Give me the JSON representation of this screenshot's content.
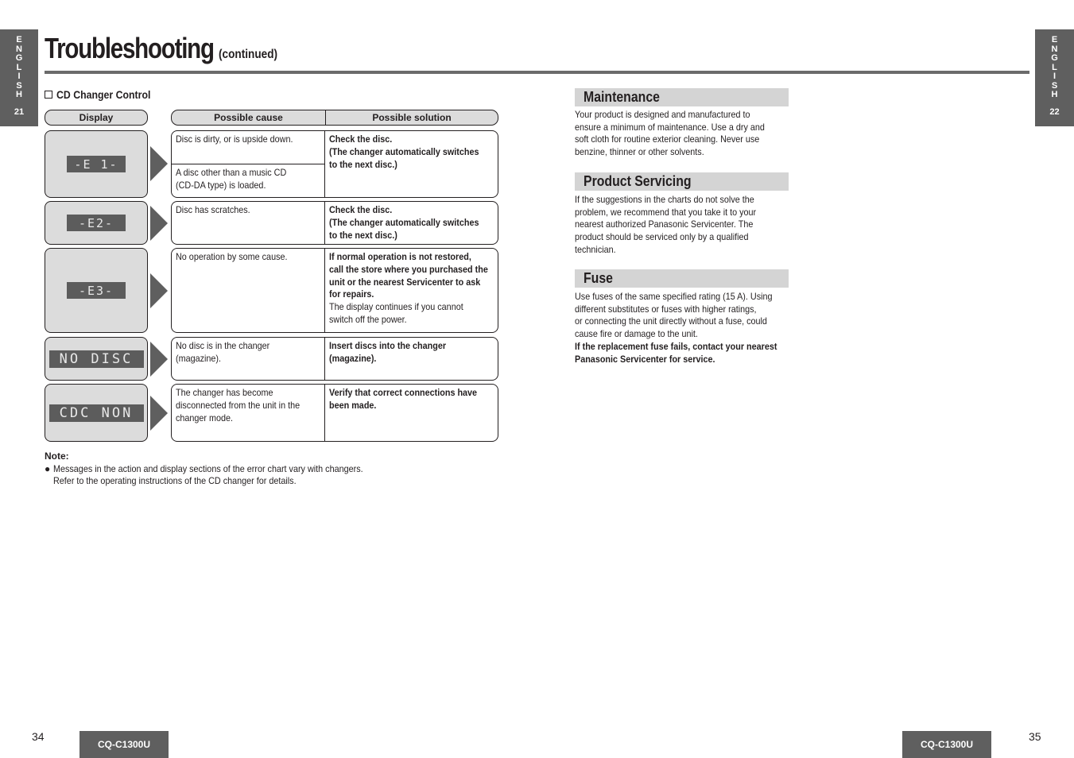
{
  "side_tabs": {
    "left": {
      "letters": [
        "E",
        "N",
        "G",
        "L",
        "I",
        "S",
        "H"
      ],
      "page": "21"
    },
    "right": {
      "letters": [
        "E",
        "N",
        "G",
        "L",
        "I",
        "S",
        "H"
      ],
      "page": "22"
    }
  },
  "header": {
    "title": "Troubleshooting",
    "subtitle": "(continued)"
  },
  "section": {
    "label": "CD Changer Control"
  },
  "table": {
    "headers": {
      "display": "Display",
      "cause": "Possible cause",
      "solution": "Possible solution"
    },
    "rows": [
      {
        "display": "-E 1-",
        "causes": [
          "Disc is dirty, or is upside down.",
          "A disc other than a music CD\n(CD-DA type) is loaded."
        ],
        "solution_bold": "Check the disc.\n(The changer automatically switches\nto the next disc.)",
        "solution_normal": ""
      },
      {
        "display": "-E2-",
        "causes": [
          "Disc has scratches."
        ],
        "solution_bold": "Check the disc.\n(The changer automatically switches\nto the next disc.)",
        "solution_normal": ""
      },
      {
        "display": "-E3-",
        "causes": [
          "No operation by some cause."
        ],
        "solution_bold": "If normal operation is not restored,\ncall the store where you purchased the\nunit or the nearest Servicenter to ask\nfor repairs.",
        "solution_normal": "The display continues if you cannot\nswitch off the power."
      },
      {
        "display": "NO DISC",
        "causes": [
          "No disc is in the changer\n(magazine)."
        ],
        "solution_bold": "Insert discs into the changer\n(magazine).",
        "solution_normal": ""
      },
      {
        "display": "CDC NON",
        "causes": [
          "The changer has become\ndisconnected from the unit in the\nchanger mode."
        ],
        "solution_bold": "Verify that correct connections have\nbeen made.",
        "solution_normal": ""
      }
    ]
  },
  "note": {
    "title": "Note:",
    "bullet": "Messages in the action and display sections of the error chart vary with changers.",
    "continuation": "Refer to the operating instructions of the CD changer for details."
  },
  "right_sections": {
    "maintenance": {
      "title": "Maintenance",
      "body": "Your product is designed and manufactured to\nensure a minimum of maintenance. Use a dry and\nsoft cloth for routine exterior cleaning. Never use\nbenzine, thinner or other solvents."
    },
    "servicing": {
      "title": "Product Servicing",
      "body": "If the suggestions in the charts do not solve the\nproblem, we recommend that you take it to your\nnearest authorized Panasonic Servicenter. The\nproduct should be serviced only by a qualified\ntechnician."
    },
    "fuse": {
      "title": "Fuse",
      "body": "Use fuses of the same specified rating (15 A). Using\ndifferent substitutes or fuses with higher ratings,\nor connecting the unit directly without a fuse, could\ncause fire or damage to the unit.",
      "body_bold": "If the replacement fuse fails, contact your nearest\nPanasonic Servicenter for service."
    }
  },
  "footer": {
    "left_page": "34",
    "right_page": "35",
    "model": "CQ-C1300U"
  }
}
